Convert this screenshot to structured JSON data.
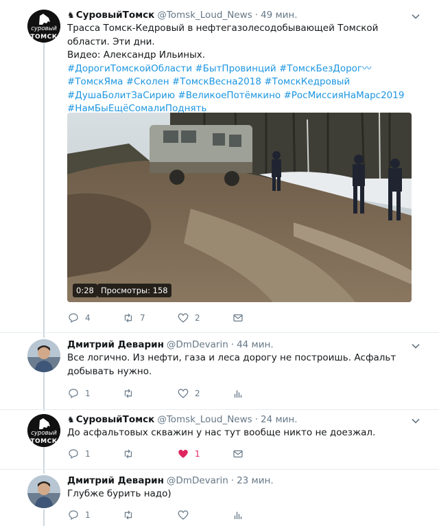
{
  "tweets": [
    {
      "name": "СуровыйТомск",
      "handle": "@Tomsk_Loud_News",
      "time": "49 мин.",
      "text_line1": "Трасса Томск-Кедровый в нефтегазолесодобывающей Томской области. Эти дни.",
      "text_line2": "Видео: Александр Ильиных.",
      "hashtags": "#ДорогиТомскойОбласти #БытПровинций #ТомскБезДорог〰#ТомскЯма #Сколен #ТомскВесна2018 #ТомскКедровый #ДушаБолитЗаСирию #ВеликоеПотёмкино #РосМиссияНаМарс2019 #НамБыЕщёСомалиПоднять",
      "video_duration": "0:28",
      "video_views": "Просмотры: 158",
      "reply_count": "4",
      "retweet_count": "7",
      "like_count": "2"
    },
    {
      "name": "Дмитрий Деварин",
      "handle": "@DmDevarin",
      "time": "44 мин.",
      "text": "Все логично. Из нефти, газа и леса дорогу не построишь. Асфальт добывать нужно.",
      "reply_count": "1",
      "retweet_count": "",
      "like_count": "2"
    },
    {
      "name": "СуровыйТомск",
      "handle": "@Tomsk_Loud_News",
      "time": "24 мин.",
      "text": "До асфальтовых скважин у нас тут вообще никто не доезжал.",
      "reply_count": "1",
      "retweet_count": "",
      "like_count": "1"
    },
    {
      "name": "Дмитрий Деварин",
      "handle": "@DmDevarin",
      "time": "23 мин.",
      "text": "Глубже бурить надо)",
      "reply_count": "1",
      "retweet_count": "",
      "like_count": ""
    }
  ],
  "avatar_logo_top": "суровый",
  "avatar_logo_bottom": "ТОМСК",
  "brand_glyph": "♞",
  "dot": "·",
  "colors": {
    "text": "#14171a",
    "secondary": "#657786",
    "link": "#1b95e0",
    "like_active": "#e0245e",
    "separator": "#e6ecf0",
    "thread_line": "#ccd6dd"
  },
  "icons": [
    "reply-icon",
    "retweet-icon",
    "like-icon",
    "message-icon",
    "analytics-icon",
    "chevron-down-icon"
  ]
}
